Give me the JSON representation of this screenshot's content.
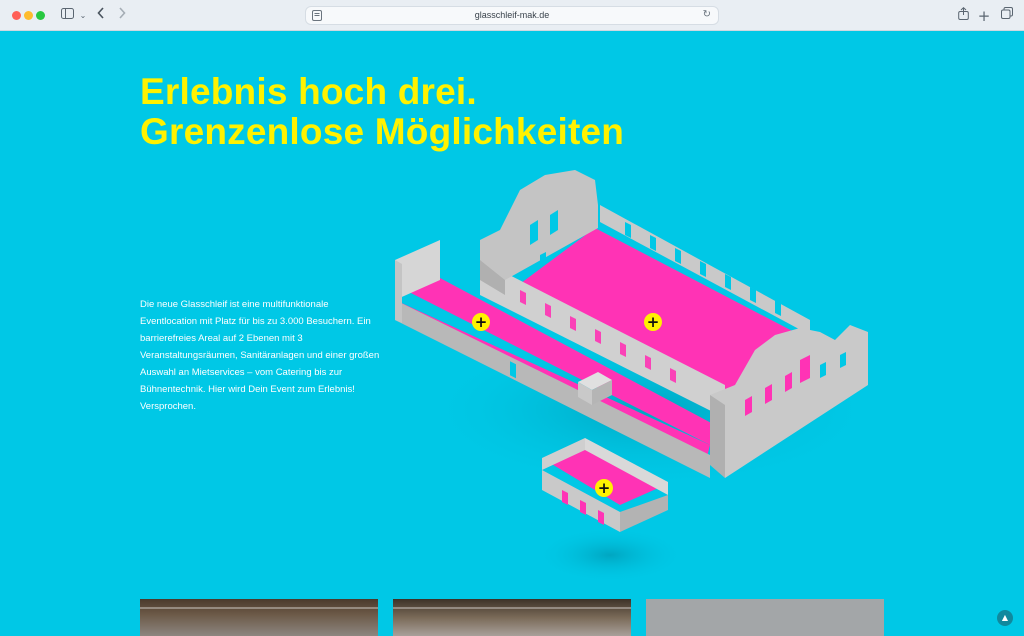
{
  "browser": {
    "url": "glasschleif-mak.de",
    "icons": [
      "sidebar-icon",
      "chevron-down-icon",
      "back-icon",
      "forward-icon",
      "reader-icon",
      "reload-icon",
      "share-icon",
      "new-tab-icon",
      "tabs-overview-icon"
    ]
  },
  "hero": {
    "headline_line1": "Erlebnis hoch drei.",
    "headline_line2": "Grenzenlose Möglichkeiten",
    "description": "Die neue Glasschleif ist eine multifunktionale Eventlocation mit Platz für bis zu 3.000 Besuchern. Ein barrierefreies Areal auf 2 Ebenen mit 3 Veranstaltungsräumen, Sanitäranlagen und einer großen Auswahl an Mietservices – vom Catering bis zur Bühnentechnik. Hier wird Dein Event zum Erlebnis! Versprochen.",
    "hotspot_symbol": "+"
  },
  "colors": {
    "background": "#00c8e6",
    "headline": "#fff200",
    "floor": "#ff33b5",
    "walls": "#c9c9c9",
    "hotspot": "#fff200"
  },
  "scroll_top_symbol": "▲"
}
